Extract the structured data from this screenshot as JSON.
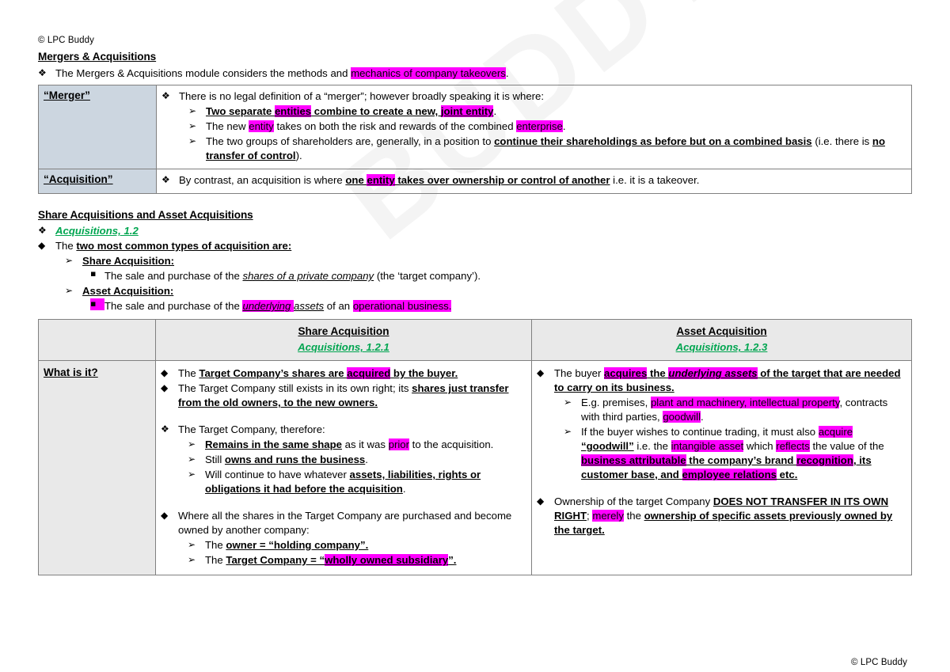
{
  "document": {
    "header_copyright": "© LPC Buddy",
    "footer_copyright": "© LPC Buddy",
    "watermark_text": "BUDDY",
    "highlight_color": "#ff00ff",
    "green_color": "#00a550",
    "merger_cell_fill": "#ccd6e0",
    "table_header_fill": "#e9e9e9"
  },
  "title": "Mergers & Acquisitions",
  "intro_bullet": {
    "bullet": "❖",
    "text_plain": "The Mergers & Acquisitions module considers the methods and ",
    "text_highlight": "mechanics of company takeovers",
    "text_tail": "."
  },
  "table1": {
    "rows": [
      {
        "label": "“Merger”",
        "lines": [
          {
            "bullet": "❖",
            "level": 1,
            "segments": [
              {
                "t": "There is no legal definition of a “merger”; however broadly speaking it is where:",
                "s": ""
              }
            ]
          },
          {
            "bullet": "➢",
            "level": 2,
            "segments": [
              {
                "t": "Two separate ",
                "s": "bu"
              },
              {
                "t": "entities",
                "s": "bu hl"
              },
              {
                "t": " combine to create a new, ",
                "s": "bu"
              },
              {
                "t": "joint entity",
                "s": "bu hl"
              },
              {
                "t": ".",
                "s": ""
              }
            ]
          },
          {
            "bullet": "➢",
            "level": 2,
            "segments": [
              {
                "t": "The new ",
                "s": ""
              },
              {
                "t": "entity",
                "s": "hl"
              },
              {
                "t": " takes on both the risk and rewards of the combined ",
                "s": ""
              },
              {
                "t": "enterprise",
                "s": "hl"
              },
              {
                "t": ".",
                "s": ""
              }
            ]
          },
          {
            "bullet": "➢",
            "level": 2,
            "segments": [
              {
                "t": "The two groups of shareholders are, generally, in a position to ",
                "s": ""
              },
              {
                "t": "continue their shareholdings as before but on a combined basis",
                "s": "bu"
              },
              {
                "t": " (i.e. there is ",
                "s": ""
              },
              {
                "t": "no transfer of control",
                "s": "bu"
              },
              {
                "t": ").",
                "s": ""
              }
            ]
          }
        ]
      },
      {
        "label": "“Acquisition”",
        "lines": [
          {
            "bullet": "❖",
            "level": 1,
            "segments": [
              {
                "t": "By contrast, an acquisition is where ",
                "s": ""
              },
              {
                "t": "one ",
                "s": "bu"
              },
              {
                "t": "entity",
                "s": "bu hl"
              },
              {
                "t": " takes over ownership or control of another",
                "s": "bu"
              },
              {
                "t": " i.e. it is a takeover.",
                "s": ""
              }
            ]
          }
        ]
      }
    ]
  },
  "section2": {
    "heading": "Share Acquisitions and Asset Acquisitions",
    "reference": "Acquisitions, 1.2",
    "reference_bullet": "❖",
    "lines": [
      {
        "bullet": "◆",
        "level": 1,
        "segments": [
          {
            "t": "The ",
            "s": ""
          },
          {
            "t": "two most common types of acquisition are:",
            "s": "bu"
          }
        ]
      },
      {
        "bullet": "➢",
        "level": 2,
        "segments": [
          {
            "t": "Share Acquisition:",
            "s": "bu"
          }
        ]
      },
      {
        "bullet": "▪",
        "level": 3,
        "segments": [
          {
            "t": "The sale and purchase of the ",
            "s": ""
          },
          {
            "t": "shares of a private company",
            "s": "iu"
          },
          {
            "t": " (the ‘target company’).",
            "s": ""
          }
        ]
      },
      {
        "bullet": "➢",
        "level": 2,
        "segments": [
          {
            "t": "Asset Acquisition:",
            "s": "bu"
          }
        ]
      },
      {
        "bullet": "▪",
        "level": 3,
        "bullet_highlight": true,
        "segments": [
          {
            "t": "The sale and purchase of the ",
            "s": ""
          },
          {
            "t": "underlying",
            "s": "iu hl"
          },
          {
            "t": " ",
            "s": "hl"
          },
          {
            "t": "assets",
            "s": "iu"
          },
          {
            "t": " of an ",
            "s": ""
          },
          {
            "t": "operational business.",
            "s": "hl"
          }
        ]
      }
    ]
  },
  "table2": {
    "headers": {
      "blank": "",
      "share": {
        "title": "Share Acquisition",
        "ref": "Acquisitions, 1.2.1"
      },
      "asset": {
        "title": "Asset Acquisition",
        "ref": "Acquisitions, 1.2.3"
      }
    },
    "row_label": "What is it?",
    "share_column": [
      {
        "bullet": "◆",
        "level": 1,
        "segments": [
          {
            "t": "The ",
            "s": ""
          },
          {
            "t": "Target Company’s shares are ",
            "s": "bu"
          },
          {
            "t": "acquired",
            "s": "bu hl"
          },
          {
            "t": " by the buyer.",
            "s": "bu"
          }
        ]
      },
      {
        "bullet": "◆",
        "level": 1,
        "segments": [
          {
            "t": "The Target Company still exists in its own right; its ",
            "s": ""
          },
          {
            "t": "shares just transfer from the old owners, to the new owners.",
            "s": "bu"
          }
        ]
      },
      {
        "gap": true
      },
      {
        "bullet": "❖",
        "level": 1,
        "segments": [
          {
            "t": "The Target Company, therefore:",
            "s": ""
          }
        ]
      },
      {
        "bullet": "➢",
        "level": 2,
        "segments": [
          {
            "t": "Remains in the same shape",
            "s": "bu"
          },
          {
            "t": " as it was ",
            "s": ""
          },
          {
            "t": "prior",
            "s": "hl"
          },
          {
            "t": " to the acquisition.",
            "s": ""
          }
        ]
      },
      {
        "bullet": "➢",
        "level": 2,
        "segments": [
          {
            "t": "Still ",
            "s": ""
          },
          {
            "t": "owns and runs the business",
            "s": "bu"
          },
          {
            "t": ".",
            "s": ""
          }
        ]
      },
      {
        "bullet": "➢",
        "level": 2,
        "segments": [
          {
            "t": "Will continue to have whatever ",
            "s": ""
          },
          {
            "t": "assets, liabilities, rights or obligations it had before the acquisition",
            "s": "bu"
          },
          {
            "t": ".",
            "s": ""
          }
        ]
      },
      {
        "gap": true
      },
      {
        "bullet": "◆",
        "level": 1,
        "segments": [
          {
            "t": "Where all the shares in the Target Company are purchased and become owned by another company:",
            "s": ""
          }
        ]
      },
      {
        "bullet": "➢",
        "level": 2,
        "segments": [
          {
            "t": "The ",
            "s": ""
          },
          {
            "t": "owner = “holding company”.",
            "s": "bu"
          }
        ]
      },
      {
        "bullet": "➢",
        "level": 2,
        "segments": [
          {
            "t": "The ",
            "s": ""
          },
          {
            "t": "Target Company = “",
            "s": "bu"
          },
          {
            "t": "wholly owned subsidiary",
            "s": "bu hl"
          },
          {
            "t": "”.",
            "s": "bu"
          }
        ]
      }
    ],
    "asset_column": [
      {
        "bullet": "◆",
        "level": 1,
        "segments": [
          {
            "t": "The buyer ",
            "s": ""
          },
          {
            "t": "acquires",
            "s": "bu hl"
          },
          {
            "t": " the ",
            "s": "bu"
          },
          {
            "t": "underlying assets",
            "s": "bu iu hl"
          },
          {
            "t": " of the target that are needed to carry on its business.",
            "s": "bu"
          }
        ]
      },
      {
        "bullet": "➢",
        "level": 2,
        "segments": [
          {
            "t": "E.g. premises, ",
            "s": ""
          },
          {
            "t": "plant and machinery, intellectual property",
            "s": "hl"
          },
          {
            "t": ", contracts with third parties, ",
            "s": ""
          },
          {
            "t": "goodwill",
            "s": "hl"
          },
          {
            "t": ".",
            "s": ""
          }
        ]
      },
      {
        "bullet": "➢",
        "level": 2,
        "segments": [
          {
            "t": "If the buyer wishes to continue trading, it must also ",
            "s": ""
          },
          {
            "t": "acquire",
            "s": "hl"
          },
          {
            "t": " ",
            "s": ""
          },
          {
            "t": "“goodwill”",
            "s": "bu"
          },
          {
            "t": " i.e. the ",
            "s": ""
          },
          {
            "t": "intangible asset",
            "s": "hl"
          },
          {
            "t": " which ",
            "s": ""
          },
          {
            "t": "reflects",
            "s": "hl"
          },
          {
            "t": " the value of the ",
            "s": ""
          },
          {
            "t": "business attributable",
            "s": "bu hl"
          },
          {
            "t": " the company’s brand ",
            "s": "bu"
          },
          {
            "t": "recognition",
            "s": "bu hl"
          },
          {
            "t": ", its customer base, and ",
            "s": "bu"
          },
          {
            "t": "employee relations",
            "s": "bu hl"
          },
          {
            "t": " etc.",
            "s": "bu"
          }
        ]
      },
      {
        "gap": true
      },
      {
        "bullet": "◆",
        "level": 1,
        "segments": [
          {
            "t": "Ownership of the target Company ",
            "s": ""
          },
          {
            "t": "DOES NOT TRANSFER IN ITS OWN RIGHT",
            "s": "bu"
          },
          {
            "t": "; ",
            "s": ""
          },
          {
            "t": "merely",
            "s": "hl"
          },
          {
            "t": " the ",
            "s": ""
          },
          {
            "t": "ownership of specific assets previously owned by the target.",
            "s": "bu"
          }
        ]
      }
    ]
  }
}
